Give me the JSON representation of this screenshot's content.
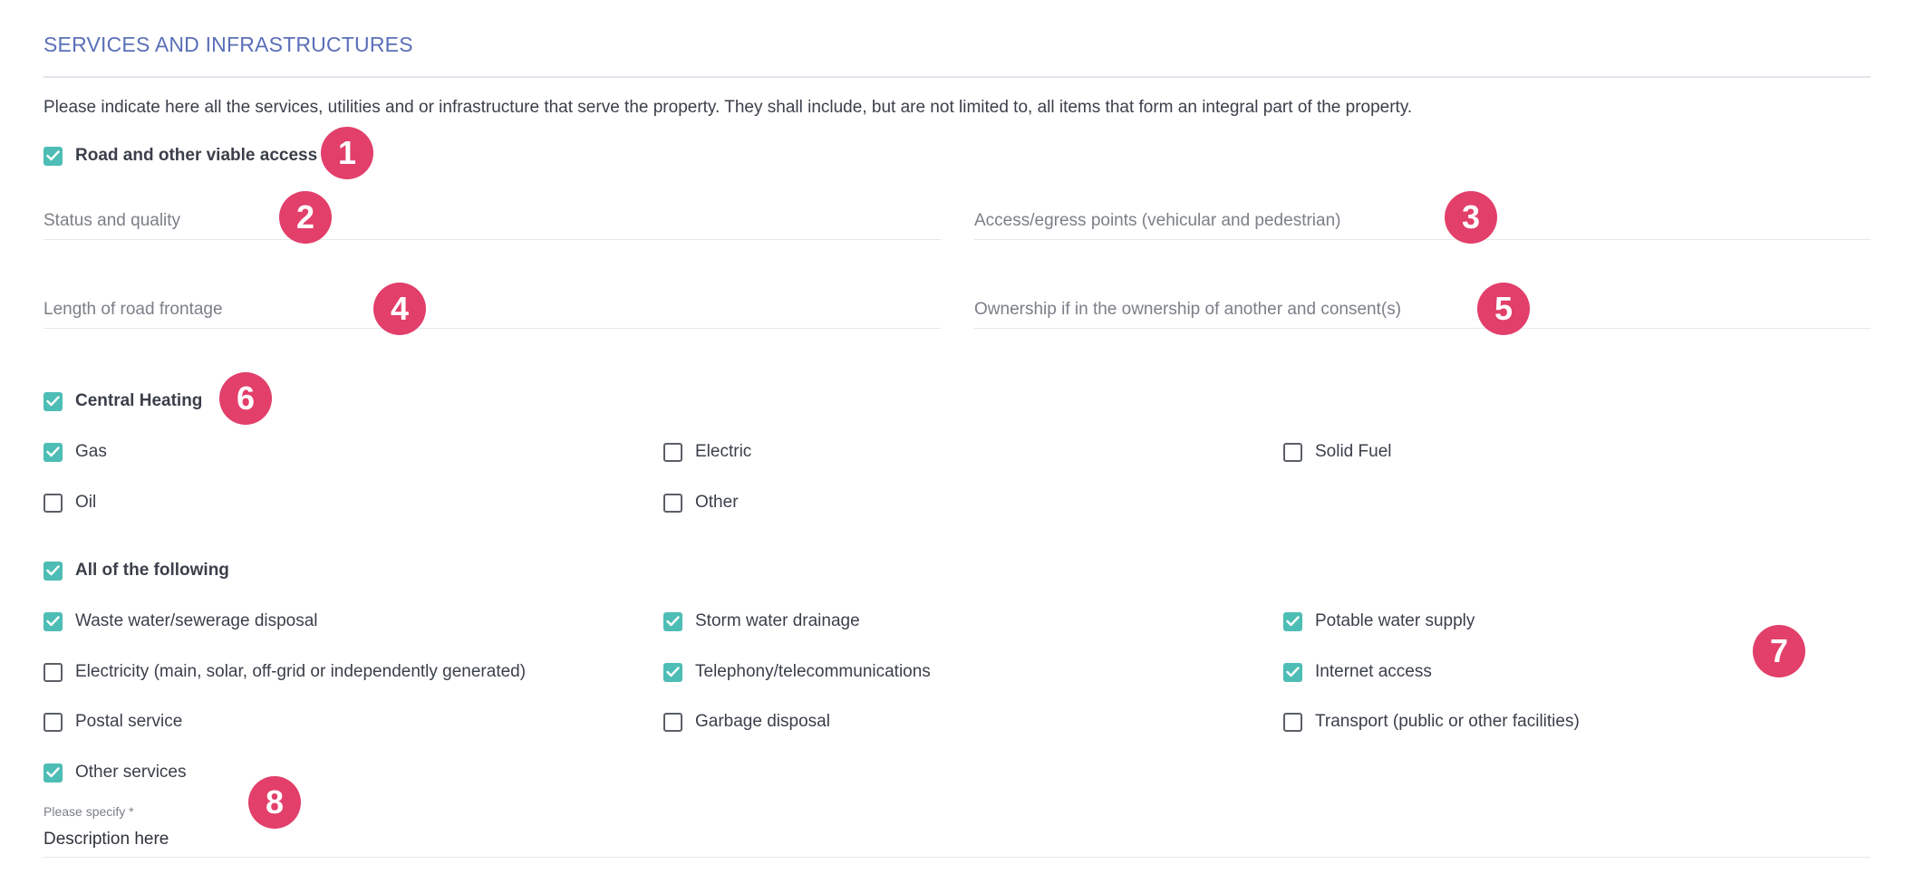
{
  "section": {
    "title": "SERVICES AND INFRASTRUCTURES",
    "intro": "Please indicate here all the services, utilities and or infrastructure that serve the property. They shall include, but are not limited to, all items that form an integral part of the property."
  },
  "road_access": {
    "label": "Road and other viable access",
    "checked": true,
    "fields": {
      "status_quality": "Status and quality",
      "access_points": "Access/egress points (vehicular and pedestrian)",
      "road_frontage": "Length of road frontage",
      "ownership": "Ownership if in the ownership of another and consent(s)"
    }
  },
  "central_heating": {
    "label": "Central Heating",
    "checked": true,
    "options": [
      {
        "label": "Gas",
        "checked": true
      },
      {
        "label": "Electric",
        "checked": false
      },
      {
        "label": "Solid Fuel",
        "checked": false
      },
      {
        "label": "Oil",
        "checked": false
      },
      {
        "label": "Other",
        "checked": false
      }
    ]
  },
  "all_following": {
    "label": "All of the following",
    "checked": true,
    "options": [
      {
        "label": "Waste water/sewerage disposal",
        "checked": true
      },
      {
        "label": "Storm water drainage",
        "checked": true
      },
      {
        "label": "Potable water supply",
        "checked": true
      },
      {
        "label": "Electricity (main, solar, off-grid or independently generated)",
        "checked": false
      },
      {
        "label": "Telephony/telecommunications",
        "checked": true
      },
      {
        "label": "Internet access",
        "checked": true
      },
      {
        "label": "Postal service",
        "checked": false
      },
      {
        "label": "Garbage disposal",
        "checked": false
      },
      {
        "label": "Transport (public or other facilities)",
        "checked": false
      },
      {
        "label": "Other services",
        "checked": true
      }
    ]
  },
  "specify": {
    "label": "Please specify *",
    "value": "Description here"
  },
  "badges": [
    "1",
    "2",
    "3",
    "4",
    "5",
    "6",
    "7",
    "8"
  ],
  "colors": {
    "title": "#5a6fb8",
    "checkbox_checked": "#4dbdb5",
    "badge": "#e23f6a"
  }
}
